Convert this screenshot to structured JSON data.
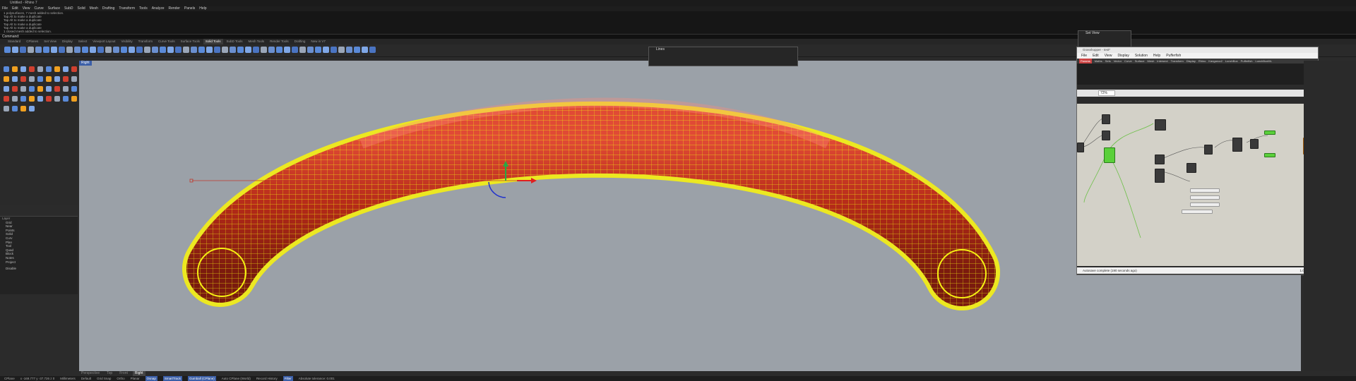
{
  "title": "Untitled - Rhino 7",
  "menu": [
    "File",
    "Edit",
    "View",
    "Curve",
    "Surface",
    "SubD",
    "Solid",
    "Mesh",
    "Drafting",
    "Transform",
    "Tools",
    "Analyze",
    "Render",
    "Panels",
    "Help"
  ],
  "command_history": [
    "1 polysurfaces, 7 mesh added to selection.",
    "Tap Alt to make a duplicate",
    "Tap Alt to make a duplicate",
    "Tap Alt to make a duplicate",
    "Tap Alt to make a duplicate",
    "1 closed mesh added to selection."
  ],
  "command_prompt": "Command:",
  "toolbar_tabs": [
    "Standard",
    "CPlanes",
    "Set View",
    "Display",
    "Select",
    "Viewport Layout",
    "Visibility",
    "Transform",
    "Curve Tools",
    "Surface Tools",
    "Solid Tools",
    "SubD Tools",
    "Mesh Tools",
    "Render Tools",
    "Drafting",
    "New in V7"
  ],
  "active_toolbar_tab": "Solid Tools",
  "viewport": {
    "label": "Right",
    "tabs": [
      "Perspective",
      "Top",
      "Front",
      "Right"
    ],
    "active_tab": "Right"
  },
  "layers": {
    "header": "Layer",
    "rows": [
      "Grid",
      "Near",
      "Points",
      "Solid",
      "Curv",
      "Plan",
      "Tool",
      "Quad",
      "Block",
      "Notes",
      "Project"
    ],
    "extra": "Disable"
  },
  "lines_panel_title": "Lines",
  "set_view_title": "Set View",
  "grasshopper": {
    "title": "Grasshopper - test*",
    "menu": [
      "File",
      "Edit",
      "View",
      "Display",
      "Solution",
      "Help",
      "Pufferfish"
    ],
    "tabs": [
      "Params",
      "Maths",
      "Sets",
      "Vector",
      "Curve",
      "Surface",
      "Mesh",
      "Intersect",
      "Transform",
      "Display",
      "Rhino",
      "Kangaroo2",
      "LunchBox",
      "Pufferfish",
      "LunchBoxML"
    ],
    "active_tab": "Params",
    "zoom": "72%",
    "status": "Autosave complete (190 seconds ago)",
    "version": "1.0.0007"
  },
  "status_bar": {
    "cplane": "CPlane",
    "coords": "x -169.777  y -37.726  z 0",
    "units": "Millimeters",
    "layer": "Default",
    "grid_snap": "Grid Snap",
    "ortho": "Ortho",
    "planar": "Planar",
    "osnap": "Osnap",
    "smarttrack": "SmartTrack",
    "gumball": "Gumball (CPlane)",
    "autocplane": "Auto CPlane (World)",
    "history": "Record History",
    "filter": "Filter",
    "tolerance": "Absolute tolerance: 0.001"
  },
  "colors": {
    "mesh_wire": "#f5f012",
    "surface": "#c4331f",
    "viewport_bg": "#9ba1a8",
    "accent": "#3b5fa8"
  }
}
